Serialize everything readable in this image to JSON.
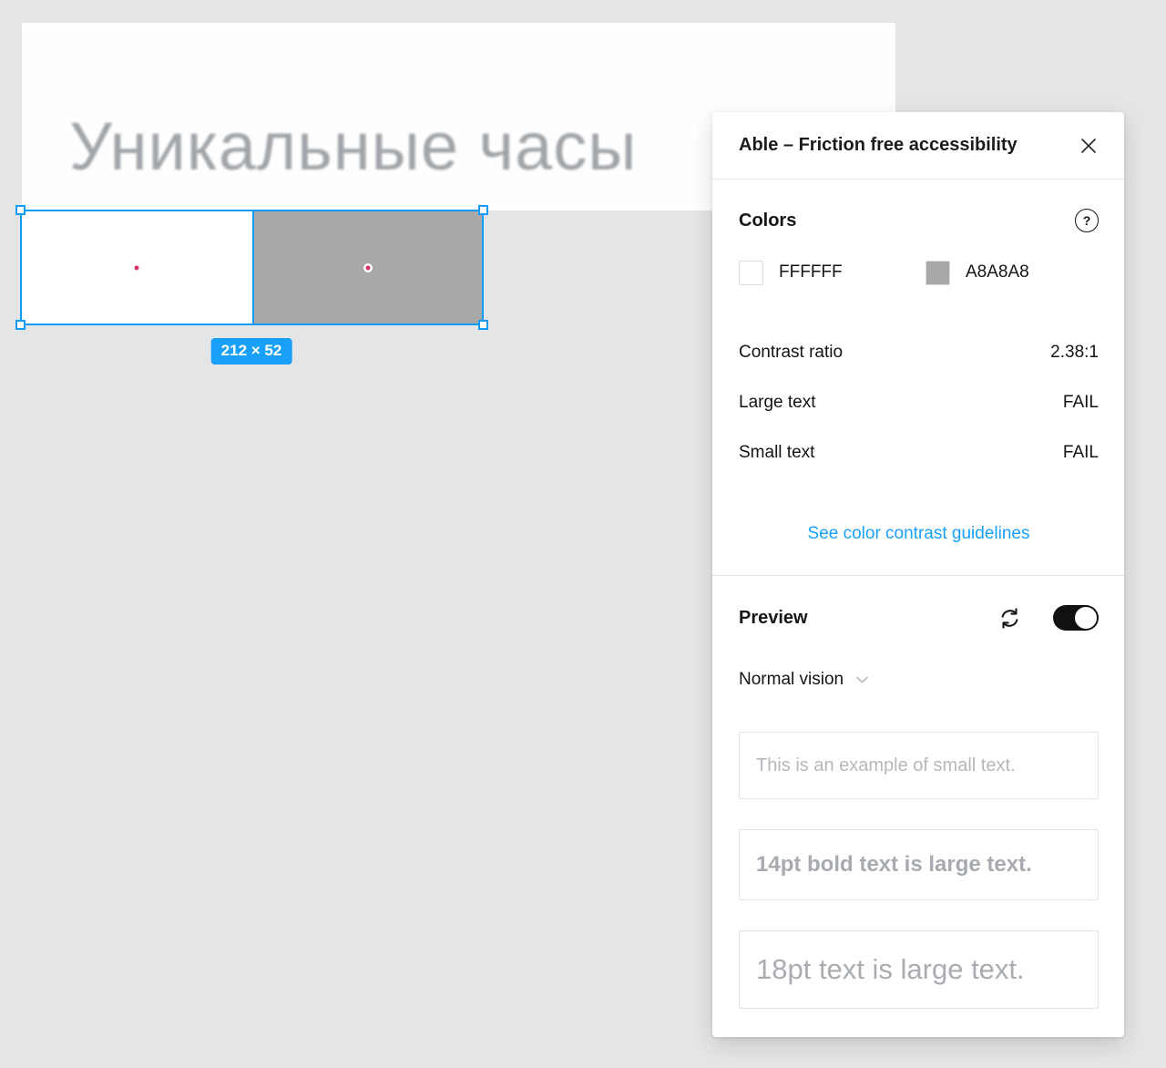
{
  "canvas": {
    "card_title": "Уникальные часы",
    "selection": {
      "size_label": "212 × 52",
      "left_fill": "#FFFFFF",
      "right_fill": "#A8A8A8",
      "accent_blue": "#18A0FB"
    }
  },
  "panel": {
    "title": "Able – Friction free accessibility",
    "colors": {
      "heading": "Colors",
      "help_label": "?",
      "swatches": [
        {
          "hex_label": "FFFFFF",
          "hex": "#FFFFFF"
        },
        {
          "hex_label": "A8A8A8",
          "hex": "#A8A8A8"
        }
      ]
    },
    "metrics": {
      "rows": [
        {
          "label": "Contrast ratio",
          "value": "2.38:1"
        },
        {
          "label": "Large text",
          "value": "FAIL"
        },
        {
          "label": "Small text",
          "value": "FAIL"
        }
      ]
    },
    "guidelines_link": "See color contrast guidelines",
    "link_color": "#18A0FB",
    "preview": {
      "heading": "Preview",
      "toggle_state": "on",
      "vision_selected": "Normal vision",
      "samples": [
        {
          "text": "This is an example of small text."
        },
        {
          "text": "14pt bold text is large text."
        },
        {
          "text": "18pt text is large text."
        }
      ]
    }
  }
}
